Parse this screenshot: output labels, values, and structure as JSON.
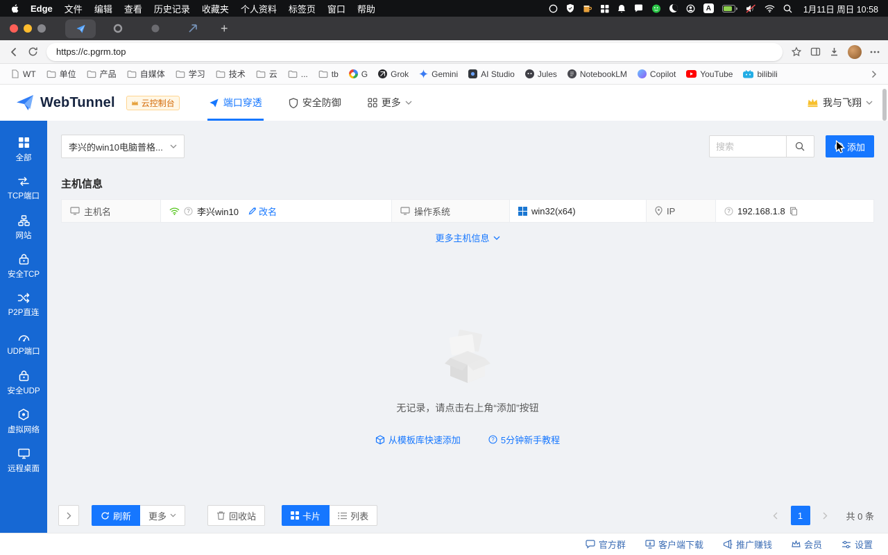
{
  "menubar": {
    "app_name": "Edge",
    "items": [
      "文件",
      "编辑",
      "查看",
      "历史记录",
      "收藏夹",
      "个人资料",
      "标签页",
      "窗口",
      "帮助"
    ],
    "clock": "1月11日 周日 10:58"
  },
  "browser": {
    "url": "https://c.pgrm.top",
    "bookmarks": [
      "WT",
      "单位",
      "产品",
      "自媒体",
      "学习",
      "技术",
      "云",
      "...",
      "tb",
      "G",
      "Grok",
      "Gemini",
      "AI Studio",
      "Jules",
      "NotebookLM",
      "Copilot",
      "YouTube",
      "bilibili"
    ]
  },
  "header": {
    "brand": "WebTunnel",
    "badge": "云控制台",
    "nav": [
      {
        "label": "端口穿透"
      },
      {
        "label": "安全防御"
      },
      {
        "label": "更多"
      }
    ],
    "user": "我与飞翔"
  },
  "sidebar": {
    "items": [
      "全部",
      "TCP端口",
      "网站",
      "安全TCP",
      "P2P直连",
      "UDP端口",
      "安全UDP",
      "虚拟网络",
      "远程桌面"
    ]
  },
  "main": {
    "host_dropdown": "李兴的win10电脑普格...",
    "search_placeholder": "搜索",
    "add_button": "添加",
    "section_title": "主机信息",
    "host_table": {
      "hostname_label": "主机名",
      "hostname_value": "李兴win10",
      "rename_link": "改名",
      "os_label": "操作系统",
      "os_value": "win32(x64)",
      "ip_label": "IP",
      "ip_value": "192.168.1.8"
    },
    "more_host_info": "更多主机信息",
    "empty": {
      "text": "无记录，请点击右上角“添加”按钮",
      "quick_add": "从模板库快速添加",
      "tutorial": "5分钟新手教程"
    },
    "toolbar": {
      "refresh": "刷新",
      "more": "更多",
      "recycle": "回收站",
      "card": "卡片",
      "list": "列表",
      "page": "1",
      "total": "共 0 条"
    }
  },
  "footer": {
    "links": [
      "官方群",
      "客户端下载",
      "推广赚钱",
      "会员",
      "设置"
    ]
  },
  "colors": {
    "primary": "#1677ff",
    "sidebar_blue": "#1668d4",
    "badge_orange": "#d46b08"
  }
}
